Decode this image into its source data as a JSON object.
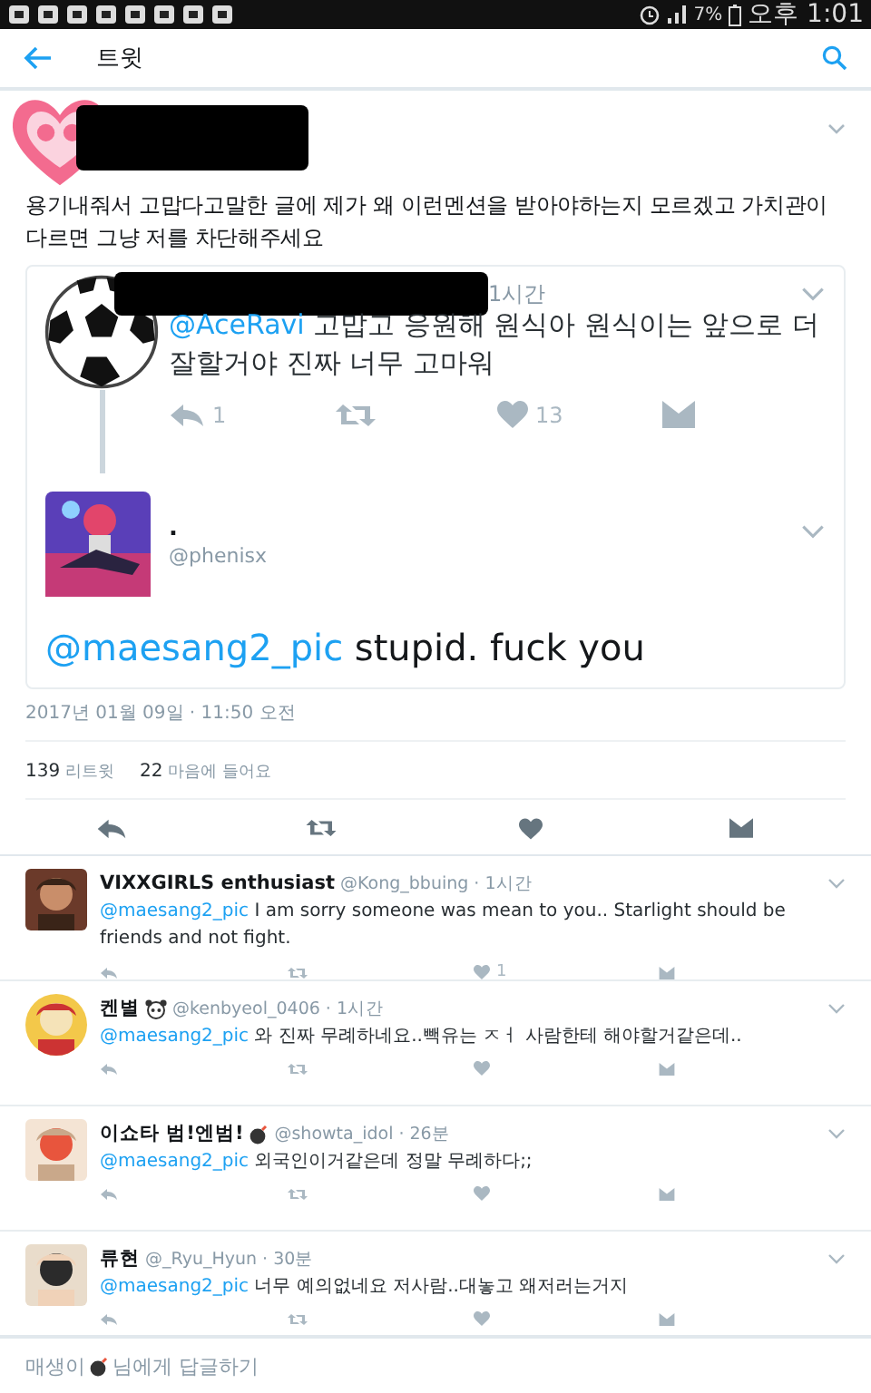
{
  "status_bar": {
    "battery": "7%",
    "time": "오후 1:01"
  },
  "header": {
    "title": "트윗"
  },
  "tweet": {
    "body": "용기내줘서 고맙다고말한 글에 제가 왜 이런멘션을 받아야하는지 모르겠고 가치관이 다르면 그냥 저를 차단해주세요",
    "card": {
      "parent": {
        "time": "1시간",
        "mention": "@AceRavi",
        "text": "고맙고 응원해 원식아 원식이는 앞으로 더 잘할거야 진짜 너무 고마워",
        "reply_count": "1",
        "like_count": "13"
      },
      "author": {
        "name": ".",
        "handle": "@phenisx"
      },
      "mention": "@maesang2_pic",
      "text": "stupid. fuck you"
    },
    "timestamp": "2017년 01월 09일 · 11:50 오전",
    "retweets": {
      "count": "139",
      "label": "리트윗"
    },
    "likes": {
      "count": "22",
      "label": "마음에 들어요"
    }
  },
  "replies": [
    {
      "name": "VIXXGIRLS enthusiast",
      "kind": "plain",
      "handle": "@Kong_bbuing",
      "time": "· 1시간",
      "mention": "@maesang2_pic",
      "text": "I am sorry someone was mean to you.. Starlight should be friends and not fight.",
      "like_count": "1"
    },
    {
      "name": "켄별",
      "kind": "panda",
      "handle": "@kenbyeol_0406",
      "time": "· 1시간",
      "mention": "@maesang2_pic",
      "text": "와 진짜 무례하네요..빽유는 ㅈㅓ 사람한테 해야할거같은데.."
    },
    {
      "name": "이쇼타 범!엔범!",
      "kind": "bomb",
      "handle": "@showta_idol",
      "time": "· 26분",
      "mention": "@maesang2_pic",
      "text": "외국인이거같은데 정말 무례하다;;"
    },
    {
      "name": "류현",
      "kind": "plain",
      "handle": "@_Ryu_Hyun",
      "time": "· 30분",
      "mention": "@maesang2_pic",
      "text": "너무 예의없네요 저사람..대놓고 왜저러는거지"
    }
  ],
  "reply_bar": {
    "name": "매생이",
    "kind": "bomb",
    "text": "님에게 답글하기"
  }
}
